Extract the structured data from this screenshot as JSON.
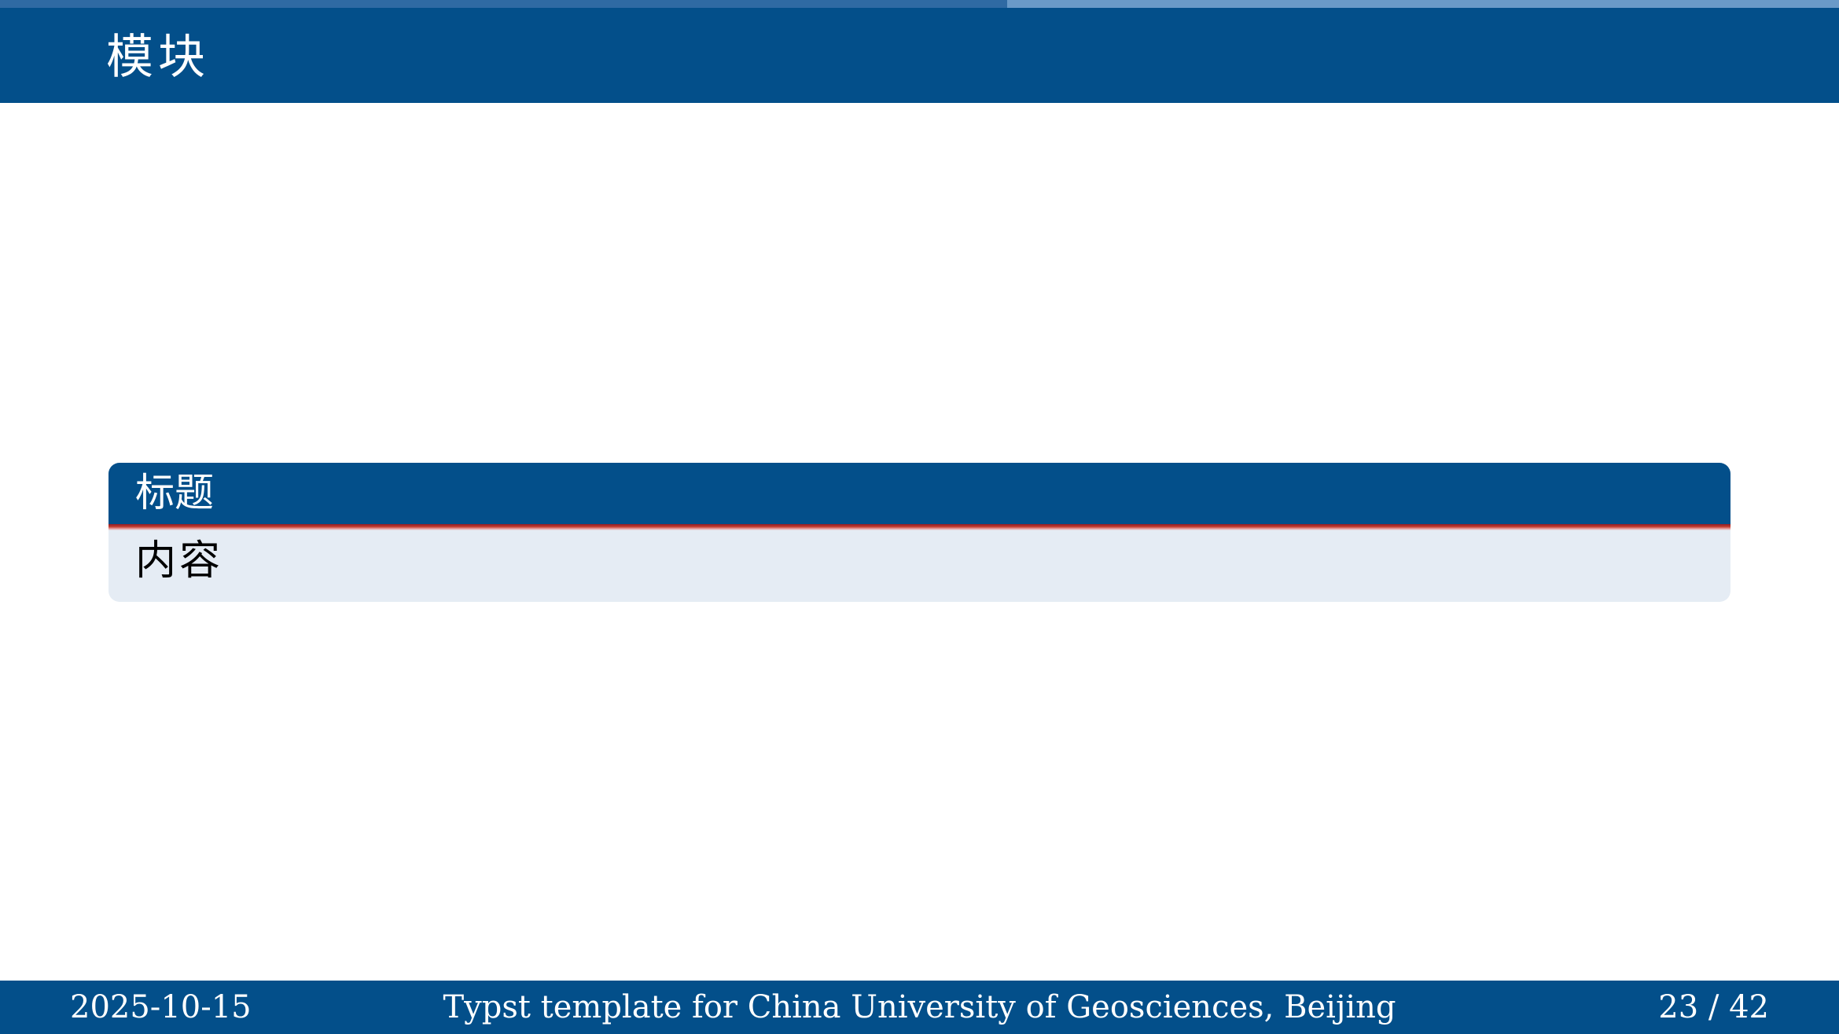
{
  "slide": {
    "title": "模块",
    "progress_fraction": 0.5476
  },
  "block": {
    "title": "标题",
    "body": "内容"
  },
  "footer": {
    "date": "2025-10-15",
    "title": "Typst template for China University of Geosciences, Beijing",
    "page": "23 / 42"
  },
  "colors": {
    "primary": "#034f8a",
    "progress_track": "#6a9ac8",
    "progress_fill": "#2f6aa3",
    "block_body_bg": "#e5ecf4",
    "accent_rule": "#c0392b"
  }
}
